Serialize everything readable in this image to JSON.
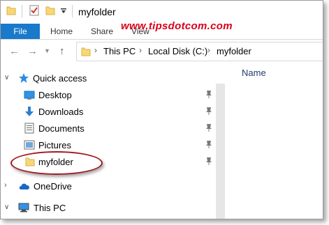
{
  "window": {
    "title": "myfolder"
  },
  "ribbon": {
    "tabs": [
      "File",
      "Home",
      "Share",
      "View"
    ],
    "watermark": "www.tipsdotcom.com"
  },
  "address": {
    "breadcrumb": [
      "This PC",
      "Local Disk (C:)",
      "myfolder"
    ]
  },
  "nav": {
    "quick_access": "Quick access",
    "items": [
      {
        "label": "Desktop",
        "icon": "desktop-icon",
        "pinned": true
      },
      {
        "label": "Downloads",
        "icon": "downloads-icon",
        "pinned": true
      },
      {
        "label": "Documents",
        "icon": "documents-icon",
        "pinned": true
      },
      {
        "label": "Pictures",
        "icon": "pictures-icon",
        "pinned": true
      },
      {
        "label": "myfolder",
        "icon": "folder-icon",
        "pinned": true,
        "highlighted": true
      }
    ],
    "onedrive": "OneDrive",
    "this_pc": "This PC"
  },
  "content": {
    "column_header": "Name"
  },
  "colors": {
    "accent": "#1979ca",
    "highlight_ellipse": "#a11a1f",
    "watermark": "#d9001b"
  }
}
